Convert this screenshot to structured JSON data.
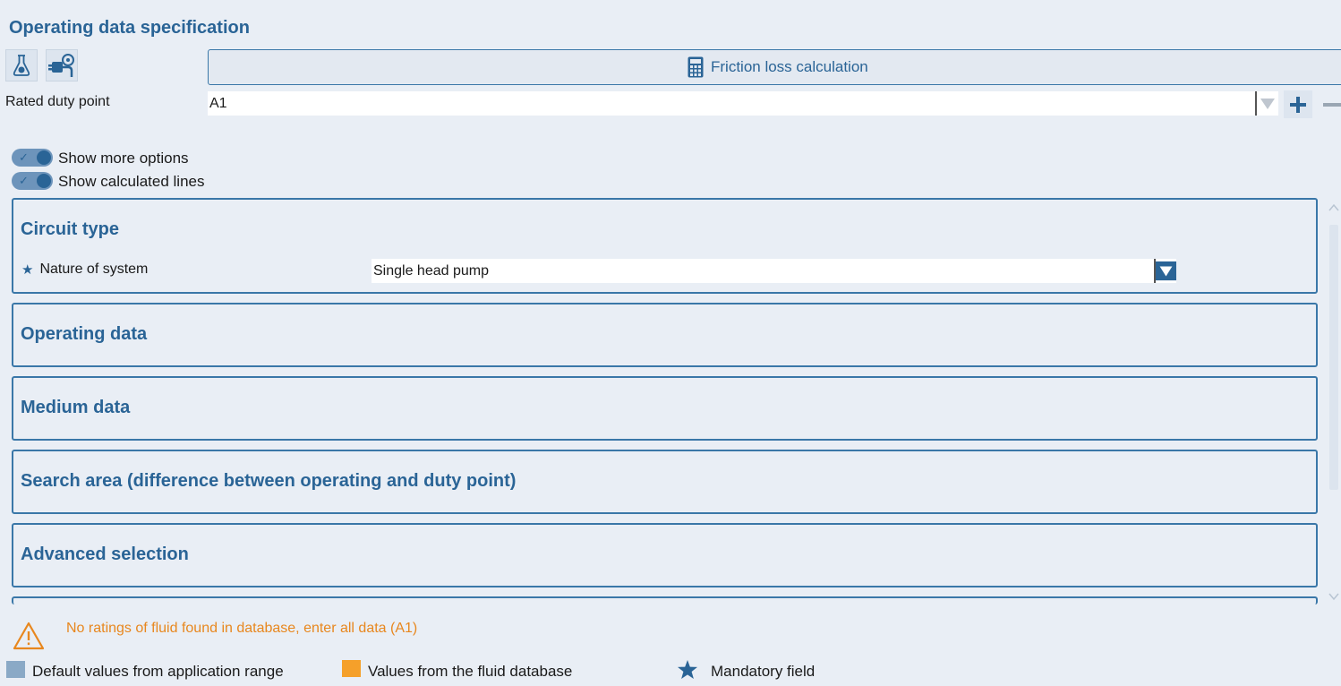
{
  "page_title": "Operating data specification",
  "toolbar": {
    "fluid_icon": "flask-icon",
    "plug_icon": "plug-settings-icon",
    "friction_button": {
      "label": "Friction loss calculation",
      "icon": "calculator-icon"
    }
  },
  "rated_duty_point": {
    "label": "Rated duty point",
    "value": "A1",
    "add_icon": "plus-icon",
    "remove_icon": "minus-icon"
  },
  "toggles": [
    {
      "label": "Show more options",
      "checked": true
    },
    {
      "label": "Show calculated lines",
      "checked": true
    }
  ],
  "sections": {
    "circuit_type": {
      "title": "Circuit type",
      "nature_label": "Nature of system",
      "nature_value": "Single head pump"
    },
    "operating_data": {
      "title": "Operating data"
    },
    "medium_data": {
      "title": "Medium data"
    },
    "search_area": {
      "title": "Search area (difference between operating and duty point)"
    },
    "advanced_selection": {
      "title": "Advanced selection"
    }
  },
  "warning": {
    "icon": "warning-triangle-icon",
    "text": "No ratings of fluid found in database, enter all data (A1)"
  },
  "legend": [
    {
      "label": "Default values from application range",
      "color": "#8aa9c6"
    },
    {
      "label": "Values from the fluid database",
      "color": "#f5a02a"
    },
    {
      "label": "Mandatory field",
      "icon": "star-icon"
    }
  ],
  "colors": {
    "accent": "#2a6496",
    "panel_border": "#3a77a8",
    "background": "#e9eef5",
    "warning": "#e8871e"
  }
}
